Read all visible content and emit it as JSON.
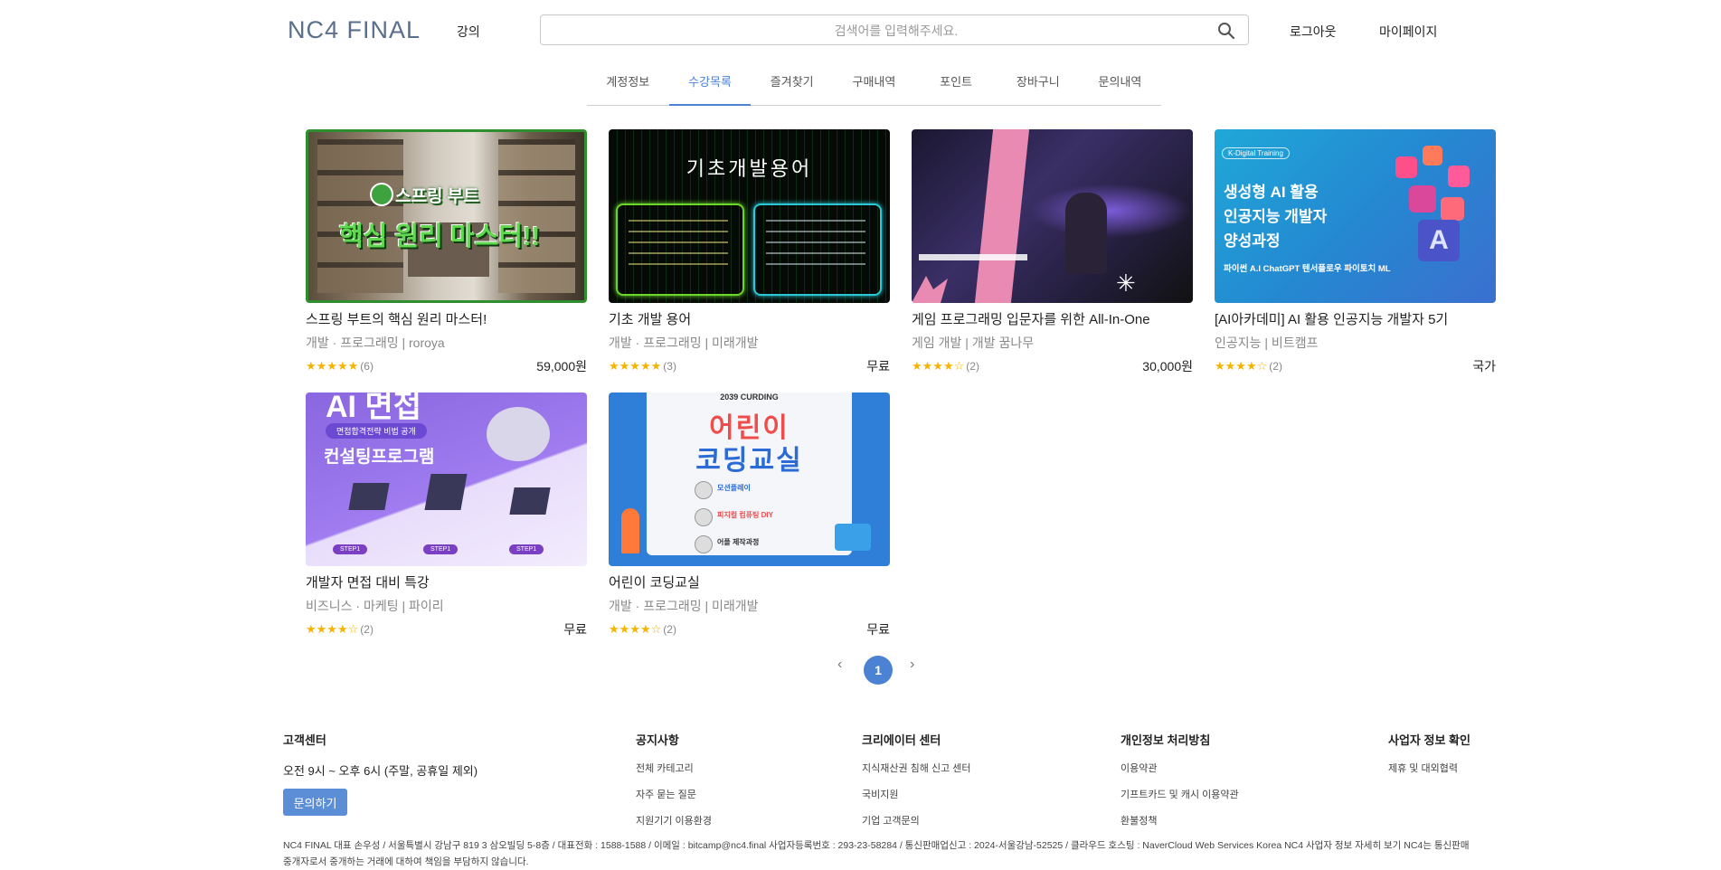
{
  "header": {
    "logo": "NC4 FINAL",
    "lecture_label": "강의",
    "search_placeholder": "검색어를 입력해주세요.",
    "logout_label": "로그아웃",
    "mypage_label": "마이페이지"
  },
  "tabs": [
    {
      "label": "계정정보",
      "active": false
    },
    {
      "label": "수강목록",
      "active": true
    },
    {
      "label": "즐겨찾기",
      "active": false
    },
    {
      "label": "구매내역",
      "active": false
    },
    {
      "label": "포인트",
      "active": false
    },
    {
      "label": "장바구니",
      "active": false
    },
    {
      "label": "문의내역",
      "active": false
    }
  ],
  "courses": [
    {
      "title": "스프링 부트의 핵심 원리 마스터!",
      "meta": "개발 · 프로그래밍 | roroya",
      "stars": "★★★★★",
      "count": "(6)",
      "price": "59,000원",
      "thumb_text_1": "스프링 부트",
      "thumb_text_2": "핵심 원리 마스터!!"
    },
    {
      "title": "기초 개발 용어",
      "meta": "개발 · 프로그래밍 | 미래개발",
      "stars": "★★★★★",
      "count": "(3)",
      "price": "무료",
      "thumb_text_1": "기초개발용어"
    },
    {
      "title": "게임 프로그래밍 입문자를 위한 All-In-One",
      "meta": "게임 개발 | 개발 꿈나무",
      "stars": "★★★★☆",
      "count": "(2)",
      "price": "30,000원"
    },
    {
      "title": "[AI아카데미] AI 활용 인공지능 개발자 5기",
      "meta": "인공지능 | 비트캠프",
      "stars": "★★★★☆",
      "count": "(2)",
      "price": "국가",
      "thumb_badge": "K-Digital Training",
      "thumb_line_1": "생성형 AI 활용",
      "thumb_line_2": "인공지능 개발자",
      "thumb_line_3": "양성과정",
      "thumb_sub": "파이썬 A.I ChatGPT 텐서플로우 파이토치 ML"
    },
    {
      "title": "개발자 면접 대비 특강",
      "meta": "비즈니스 · 마케팅 | 파이리",
      "stars": "★★★★☆",
      "count": "(2)",
      "price": "무료",
      "thumb_text_1": "AI 면접",
      "thumb_badge": "면접합격전략 비법 공개",
      "thumb_text_2": "컨설팅프로그램",
      "thumb_step": "STEP1"
    },
    {
      "title": "어린이 코딩교실",
      "meta": "개발 · 프로그래밍 | 미래개발",
      "stars": "★★★★☆",
      "count": "(2)",
      "price": "무료",
      "thumb_top": "2039 CURDING",
      "thumb_text_1": "어린이",
      "thumb_text_2": "코딩교실",
      "thumb_item_1": "모션플레이",
      "thumb_item_2": "피지컬 컴퓨팅 DIY",
      "thumb_item_3": "어플 제작과정"
    }
  ],
  "pagination": {
    "current": "1",
    "prev": "‹",
    "next": "›"
  },
  "footer": {
    "cs_title": "고객센터",
    "hours": "오전 9시 ~ 오후 6시 (주말, 공휴일 제외)",
    "inquiry_button": "문의하기",
    "notice_title": "공지사항",
    "notice_links": [
      "전체 카테고리",
      "자주 묻는 질문",
      "지원기기 이용환경"
    ],
    "creator_title": "크리에이터 센터",
    "creator_links": [
      "지식재산권 침해 신고 센터",
      "국비지원",
      "기업 고객문의"
    ],
    "privacy_title": "개인정보 처리방침",
    "privacy_links": [
      "이용약관",
      "기프트카드 및 캐시 이용약관",
      "환불정책"
    ],
    "biz_title": "사업자 정보 확인",
    "biz_links": [
      "제휴 및 대외협력"
    ],
    "company_info": "NC4 FINAL 대표 손우성 / 서울특별시 강남구 819 3 삼오빌딩 5-8층 / 대표전화 : 1588-1588 / 이메일 : bitcamp@nc4.final 사업자등록번호 : 293-23-58284 / 통신판매업신고 : 2024-서울강남-52525 / 클라우드 호스팅 : NaverCloud Web Services Korea NC4 사업자 정보 자세히 보기 NC4는 통신판매중개자로서 중개하는 거래에 대하여 책임을 부담하지 않습니다."
  },
  "colors": {
    "accent": "#4c82d4",
    "star": "#f5b400"
  }
}
